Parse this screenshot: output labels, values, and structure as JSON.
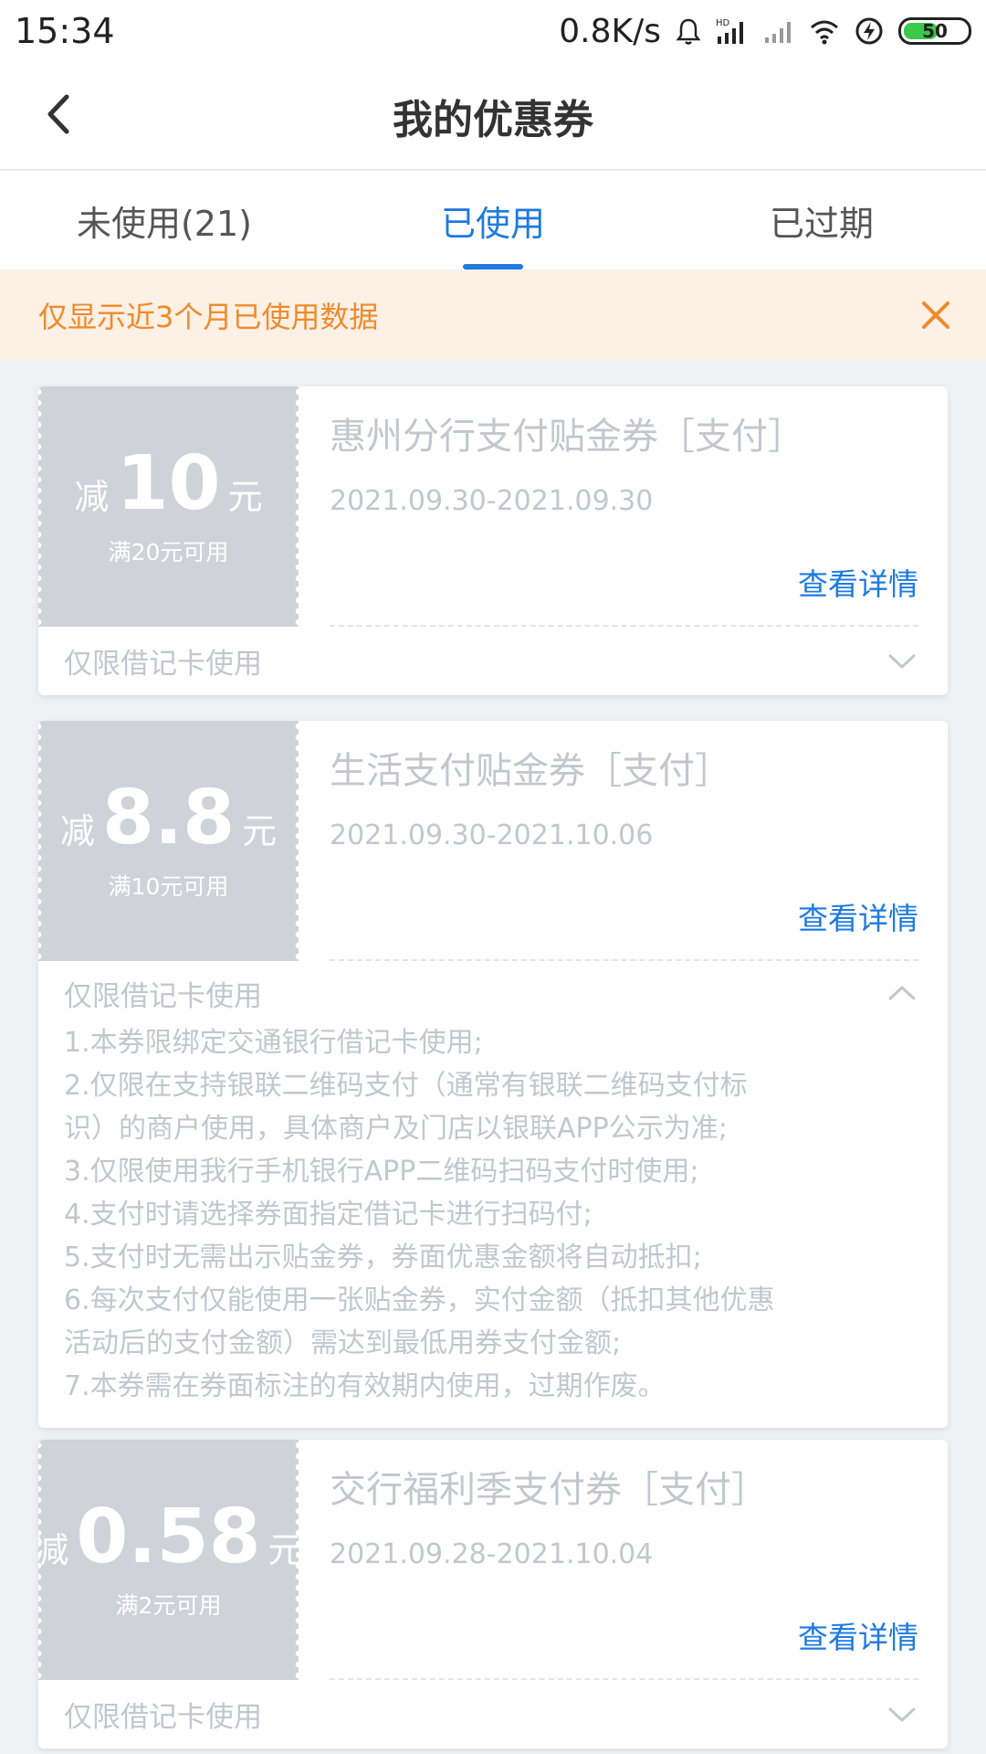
{
  "status_bar": {
    "time": "15:34",
    "network_speed": "0.8K/s",
    "battery": "50"
  },
  "header": {
    "title": "我的优惠券"
  },
  "tabs": [
    {
      "label": "未使用(21)",
      "active": false
    },
    {
      "label": "已使用",
      "active": true
    },
    {
      "label": "已过期",
      "active": false
    }
  ],
  "notice": {
    "text": "仅显示近3个月已使用数据"
  },
  "coupons": [
    {
      "prefix": "减",
      "amount": "10",
      "unit": "元",
      "condition": "满20元可用",
      "name": "惠州分行支付贴金券［支付］",
      "date": "2021.09.30-2021.09.30",
      "detail_label": "查看详情",
      "limit": "仅限借记卡使用",
      "expanded": false
    },
    {
      "prefix": "减",
      "amount": "8.8",
      "unit": "元",
      "condition": "满10元可用",
      "name": "生活支付贴金券［支付］",
      "date": "2021.09.30-2021.10.06",
      "detail_label": "查看详情",
      "limit": "仅限借记卡使用",
      "expanded": true,
      "rules": [
        "1.本券限绑定交通银行借记卡使用;",
        "2.仅限在支持银联二维码支付（通常有银联二维码支付标",
        "识）的商户使用，具体商户及门店以银联APP公示为准;",
        "3.仅限使用我行手机银行APP二维码扫码支付时使用;",
        "4.支付时请选择券面指定借记卡进行扫码付;",
        "5.支付时无需出示贴金券，券面优惠金额将自动抵扣;",
        "6.每次支付仅能使用一张贴金券，实付金额（抵扣其他优惠",
        "活动后的支付金额）需达到最低用券支付金额;",
        "7.本券需在券面标注的有效期内使用，过期作废。"
      ]
    },
    {
      "prefix": "减",
      "amount": "0.58",
      "unit": "元",
      "condition": "满2元可用",
      "name": "交行福利季支付券［支付］",
      "date": "2021.09.28-2021.10.04",
      "detail_label": "查看详情",
      "limit": "仅限借记卡使用",
      "expanded": false
    }
  ],
  "colors": {
    "accent": "#1f7ae0",
    "notice_text": "#f08a2c",
    "notice_bg": "#fdf0e4",
    "stub_bg": "#cfd2d8",
    "muted_text": "#c3c6cc"
  }
}
